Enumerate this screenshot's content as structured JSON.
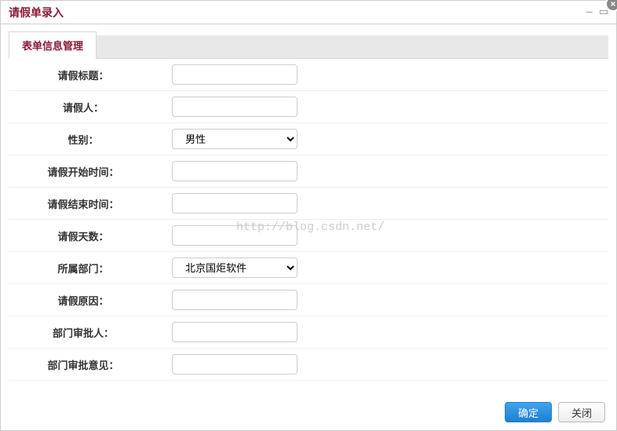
{
  "dialog": {
    "title": "请假单录入"
  },
  "tabs": {
    "active": "表单信息管理"
  },
  "fields": {
    "leave_title": {
      "label": "请假标题：",
      "value": ""
    },
    "applicant": {
      "label": "请假人：",
      "value": ""
    },
    "gender": {
      "label": "性别：",
      "selected": "男性"
    },
    "start_time": {
      "label": "请假开始时间：",
      "value": ""
    },
    "end_time": {
      "label": "请假结束时间：",
      "value": ""
    },
    "days": {
      "label": "请假天数：",
      "value": ""
    },
    "department": {
      "label": "所属部门：",
      "selected": "北京国炬软件"
    },
    "reason": {
      "label": "请假原因：",
      "value": ""
    },
    "approver": {
      "label": "部门审批人：",
      "value": ""
    },
    "approval_comment": {
      "label": "部门审批意见：",
      "value": ""
    }
  },
  "buttons": {
    "ok": "确定",
    "close": "关闭"
  },
  "watermark": "http://blog.csdn.net/"
}
